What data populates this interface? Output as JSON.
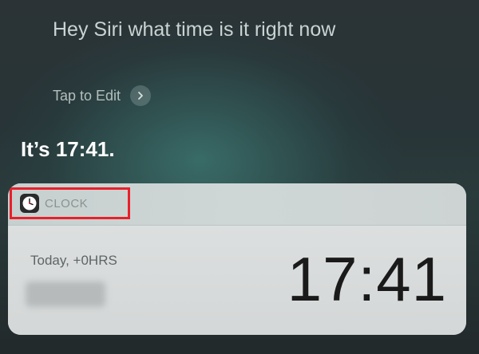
{
  "siri": {
    "query": "Hey Siri what time is it right now",
    "edit_label": "Tap to Edit",
    "answer": "It’s 17:41."
  },
  "clock_card": {
    "app_name": "CLOCK",
    "day_label": "Today, +0HRS",
    "time": "17:41",
    "highlight_color": "#e8202a"
  },
  "icons": {
    "edit": "chevron-right-icon",
    "app": "clock-icon"
  }
}
